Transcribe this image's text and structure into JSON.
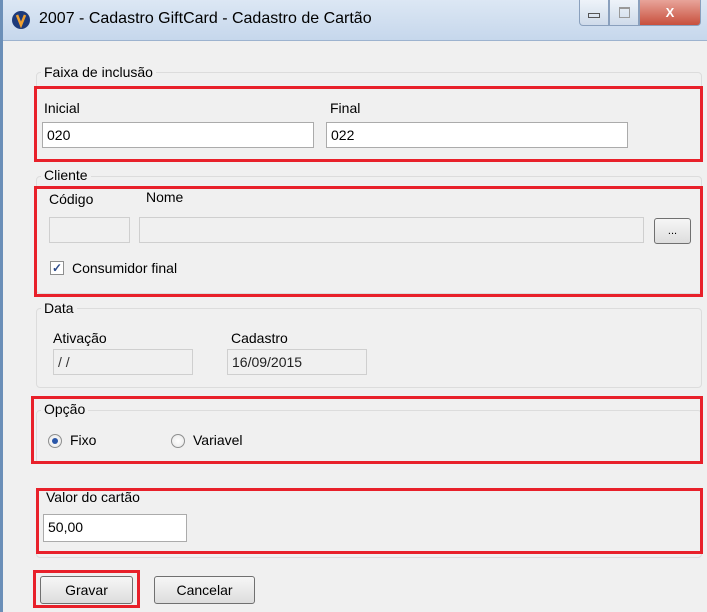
{
  "window": {
    "title": "2007 - Cadastro GiftCard - Cadastro de Cartão",
    "minimize_icon": "minimize-icon",
    "maximize_icon": "maximize-icon",
    "close_label": "X"
  },
  "faixa": {
    "group_label": "Faixa de inclusão",
    "inicial_label": "Inicial",
    "inicial_value": "020",
    "final_label": "Final",
    "final_value": "022"
  },
  "cliente": {
    "group_label": "Cliente",
    "codigo_label": "Código",
    "nome_label": "Nome",
    "codigo_value": "",
    "nome_value": "",
    "browse_label": "...",
    "consumidor_label": "Consumidor final",
    "consumidor_checked": true
  },
  "data": {
    "group_label": "Data",
    "ativacao_label": "Ativação",
    "ativacao_value": " / /",
    "cadastro_label": "Cadastro",
    "cadastro_value": "16/09/2015"
  },
  "opcao": {
    "group_label": "Opção",
    "fixo_label": "Fixo",
    "variavel_label": "Variavel",
    "selected": "Fixo"
  },
  "valor": {
    "group_label": "Valor do cartão",
    "value": "50,00"
  },
  "actions": {
    "gravar_label": "Gravar",
    "cancelar_label": "Cancelar"
  },
  "colors": {
    "highlight": "#e8202a",
    "radio_accent": "#2a56a8"
  }
}
